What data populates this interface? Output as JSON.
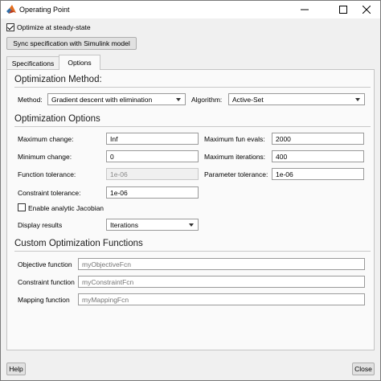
{
  "window": {
    "title": "Operating Point",
    "buttons": {
      "minimize": "minimize",
      "maximize": "maximize",
      "close": "close"
    }
  },
  "top": {
    "optimize_label": "Optimize at steady-state",
    "optimize_checked": true,
    "sync_button": "Sync specification with Simulink model"
  },
  "tabs": [
    {
      "label": "Specifications",
      "active": false
    },
    {
      "label": "Options",
      "active": true
    }
  ],
  "optimization_method": {
    "title": "Optimization Method:",
    "method_label": "Method:",
    "method_value": "Gradient descent with elimination",
    "algorithm_label": "Algorithm:",
    "algorithm_value": "Active-Set"
  },
  "optimization_options": {
    "title": "Optimization Options",
    "max_change_label": "Maximum change:",
    "max_change_value": "Inf",
    "min_change_label": "Minimum change:",
    "min_change_value": "0",
    "function_tol_label": "Function tolerance:",
    "function_tol_value": "1e-06",
    "constraint_tol_label": "Constraint tolerance:",
    "constraint_tol_value": "1e-06",
    "max_fun_evals_label": "Maximum fun evals:",
    "max_fun_evals_value": "2000",
    "max_iterations_label": "Maximum iterations:",
    "max_iterations_value": "400",
    "parameter_tol_label": "Parameter tolerance:",
    "parameter_tol_value": "1e-06",
    "jacobian_label": "Enable analytic Jacobian",
    "jacobian_checked": false,
    "display_label": "Display results",
    "display_value": "Iterations"
  },
  "custom_functions": {
    "title": "Custom Optimization Functions",
    "objective_label": "Objective function",
    "objective_placeholder": "myObjectiveFcn",
    "constraint_label": "Constraint function",
    "constraint_placeholder": "myConstraintFcn",
    "mapping_label": "Mapping function",
    "mapping_placeholder": "myMappingFcn"
  },
  "footer": {
    "help_button": "Help",
    "close_button": "Close"
  },
  "colors": {
    "matlab_icon_orange": "#e36c1c",
    "matlab_icon_red": "#b5391e",
    "matlab_icon_blue": "#2f6ea8"
  }
}
